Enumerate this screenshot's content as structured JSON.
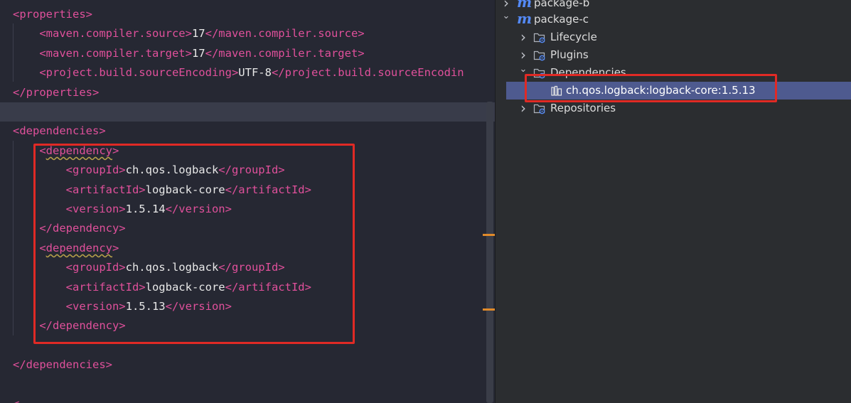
{
  "editor": {
    "lines": [
      {
        "parts": [
          [
            "tag",
            "<properties>"
          ]
        ]
      },
      {
        "parts": [
          [
            "tag",
            "    <maven.compiler.source>"
          ],
          [
            "txt",
            "17"
          ],
          [
            "tag",
            "</maven.compiler.source>"
          ]
        ]
      },
      {
        "parts": [
          [
            "tag",
            "    <maven.compiler.target>"
          ],
          [
            "txt",
            "17"
          ],
          [
            "tag",
            "</maven.compiler.target>"
          ]
        ]
      },
      {
        "parts": [
          [
            "tag",
            "    <project.build.sourceEncoding>"
          ],
          [
            "txt",
            "UTF-8"
          ],
          [
            "tag",
            "</project.build.sourceEncodin"
          ]
        ]
      },
      {
        "parts": [
          [
            "tag",
            "</properties>"
          ]
        ]
      },
      {
        "parts": []
      },
      {
        "parts": [
          [
            "tag",
            "<dependencies>"
          ]
        ]
      },
      {
        "parts": [
          [
            "tag",
            "    <"
          ],
          [
            "warn",
            "dependency"
          ],
          [
            "tag",
            ">"
          ]
        ]
      },
      {
        "parts": [
          [
            "tag",
            "        <groupId>"
          ],
          [
            "txt",
            "ch.qos.logback"
          ],
          [
            "tag",
            "</groupId>"
          ]
        ]
      },
      {
        "parts": [
          [
            "tag",
            "        <artifactId>"
          ],
          [
            "txt",
            "logback-core"
          ],
          [
            "tag",
            "</artifactId>"
          ]
        ]
      },
      {
        "parts": [
          [
            "tag",
            "        <version>"
          ],
          [
            "txt",
            "1.5.14"
          ],
          [
            "tag",
            "</version>"
          ]
        ]
      },
      {
        "parts": [
          [
            "tag",
            "    </dependency>"
          ]
        ]
      },
      {
        "parts": [
          [
            "tag",
            "    <"
          ],
          [
            "warn",
            "dependency"
          ],
          [
            "tag",
            ">"
          ]
        ]
      },
      {
        "parts": [
          [
            "tag",
            "        <groupId>"
          ],
          [
            "txt",
            "ch.qos.logback"
          ],
          [
            "tag",
            "</groupId>"
          ]
        ]
      },
      {
        "parts": [
          [
            "tag",
            "        <artifactId>"
          ],
          [
            "txt",
            "logback-core"
          ],
          [
            "tag",
            "</artifactId>"
          ]
        ]
      },
      {
        "parts": [
          [
            "tag",
            "        <version>"
          ],
          [
            "txt",
            "1.5.13"
          ],
          [
            "tag",
            "</version>"
          ]
        ]
      },
      {
        "parts": [
          [
            "tag",
            "    </dependency>"
          ]
        ]
      },
      {
        "parts": []
      },
      {
        "parts": [
          [
            "tag",
            "</dependencies>"
          ]
        ]
      },
      {
        "parts": []
      },
      {
        "parts": [
          [
            "tag",
            "<"
          ]
        ]
      }
    ]
  },
  "maven_tree": {
    "rows": [
      {
        "label": "package-b",
        "chevron": "right",
        "icon": "maven-module-icon",
        "depth": 0
      },
      {
        "label": "package-c",
        "chevron": "down",
        "icon": "maven-module-icon",
        "depth": 0
      },
      {
        "label": "Lifecycle",
        "chevron": "right",
        "icon": "folder-gear-icon",
        "depth": 1
      },
      {
        "label": "Plugins",
        "chevron": "right",
        "icon": "folder-gear-icon",
        "depth": 1
      },
      {
        "label": "Dependencies",
        "chevron": "down",
        "icon": "folder-gear-icon",
        "depth": 1
      },
      {
        "label": "ch.qos.logback:logback-core:1.5.13",
        "chevron": "",
        "icon": "library-icon",
        "depth": 2,
        "selected": true
      },
      {
        "label": "Repositories",
        "chevron": "right",
        "icon": "folder-gear-icon",
        "depth": 1
      }
    ]
  },
  "colors": {
    "tag": "#e0509b",
    "text": "#e8e8e8",
    "editor_bg": "#262833",
    "panel_bg": "#2b2d30",
    "selection": "#4e5a8f",
    "annotation_red": "#e02a25",
    "maven_blue": "#548af7"
  }
}
